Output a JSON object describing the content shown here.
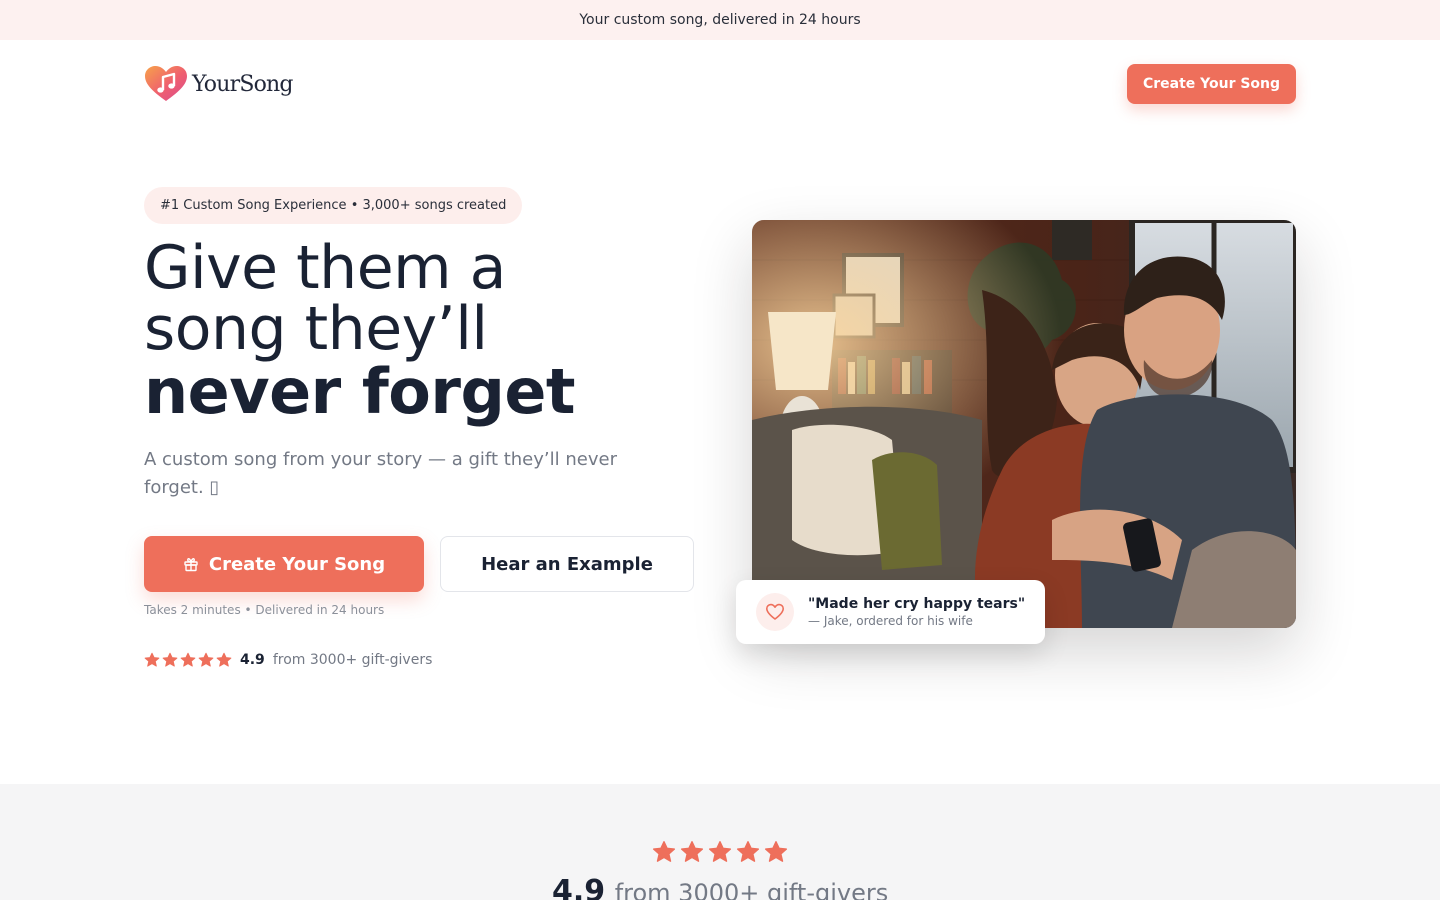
{
  "announcement": {
    "text": "Your custom song, delivered in 24 hours"
  },
  "header": {
    "logo_text": "YourSong",
    "cta_label": "Create Your Song"
  },
  "hero": {
    "pill_text": "#1 Custom Song Experience • 3,000+ songs created",
    "headline_line1": "Give them a",
    "headline_line2": "song they’ll",
    "headline_line3": "never forget",
    "subtitle": "A custom song from your story — a gift they’ll never forget. ▯",
    "primary_cta": "Create Your Song",
    "secondary_cta": "Hear an Example",
    "note": "Takes 2 minutes • Delivered in 24 hours",
    "rating": {
      "stars": 5,
      "score": "4.9",
      "from": "from 3000+ gift-givers"
    }
  },
  "testimonial": {
    "quote": "\"Made her cry happy tears\"",
    "author": "— Jake, ordered for his wife"
  },
  "social_proof": {
    "stars": 5,
    "score": "4.9",
    "from": "from 3000+ gift-givers"
  },
  "colors": {
    "brand": "#ee6f5b",
    "announcement_bg": "#fdf1f0",
    "heading": "#1a2233",
    "muted": "#737985",
    "band_bg": "#f5f5f6"
  },
  "icons": {
    "logo": "heart-music-note-icon",
    "primary_cta": "gift-icon",
    "rating": "star-icon",
    "testimonial": "heart-icon"
  }
}
